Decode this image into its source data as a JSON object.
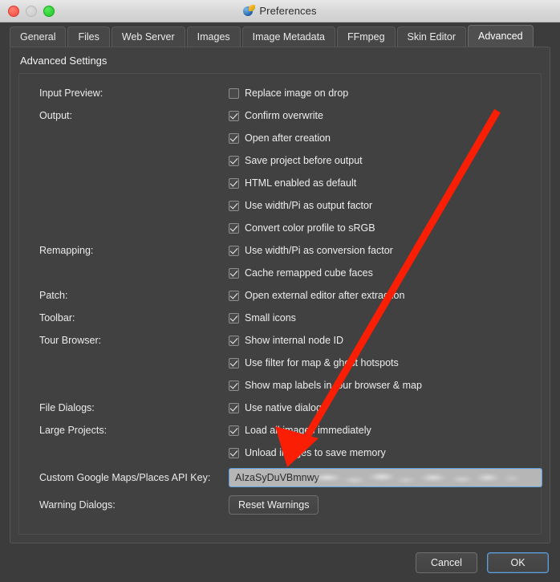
{
  "window": {
    "title": "Preferences",
    "icon": "globe-app-icon",
    "traffic_lights": [
      "close",
      "minimize",
      "maximize"
    ]
  },
  "tabs": [
    {
      "label": "General",
      "active": false
    },
    {
      "label": "Files",
      "active": false
    },
    {
      "label": "Web Server",
      "active": false
    },
    {
      "label": "Images",
      "active": false
    },
    {
      "label": "Image Metadata",
      "active": false
    },
    {
      "label": "FFmpeg",
      "active": false
    },
    {
      "label": "Skin Editor",
      "active": false
    },
    {
      "label": "Advanced",
      "active": true
    }
  ],
  "panel": {
    "title": "Advanced Settings",
    "rows": [
      {
        "label": "Input Preview:",
        "checkbox": {
          "label": "Replace image on drop",
          "checked": false
        }
      },
      {
        "label": "Output:",
        "checkbox": {
          "label": "Confirm overwrite",
          "checked": true
        }
      },
      {
        "label": "",
        "checkbox": {
          "label": "Open after creation",
          "checked": true
        }
      },
      {
        "label": "",
        "checkbox": {
          "label": "Save project before output",
          "checked": true
        }
      },
      {
        "label": "",
        "checkbox": {
          "label": "HTML enabled as default",
          "checked": true
        }
      },
      {
        "label": "",
        "checkbox": {
          "label": "Use width/Pi as output factor",
          "checked": true
        }
      },
      {
        "label": "",
        "checkbox": {
          "label": "Convert color profile to sRGB",
          "checked": true
        }
      },
      {
        "label": "Remapping:",
        "checkbox": {
          "label": "Use width/Pi as conversion factor",
          "checked": true
        }
      },
      {
        "label": "",
        "checkbox": {
          "label": "Cache remapped cube faces",
          "checked": true
        }
      },
      {
        "label": "Patch:",
        "checkbox": {
          "label": "Open external editor after extraction",
          "checked": true
        }
      },
      {
        "label": "Toolbar:",
        "checkbox": {
          "label": "Small icons",
          "checked": true
        }
      },
      {
        "label": "Tour Browser:",
        "checkbox": {
          "label": "Show internal node ID",
          "checked": true
        }
      },
      {
        "label": "",
        "checkbox": {
          "label": "Use filter for map & ghost hotspots",
          "checked": true
        }
      },
      {
        "label": "",
        "checkbox": {
          "label": "Show map labels in tour browser & map",
          "checked": true
        }
      },
      {
        "label": "File Dialogs:",
        "checkbox": {
          "label": "Use native dialogs",
          "checked": true
        }
      },
      {
        "label": "Large Projects:",
        "checkbox": {
          "label": "Load all images immediately",
          "checked": true
        }
      },
      {
        "label": "",
        "checkbox": {
          "label": "Unload images to save memory",
          "checked": true
        }
      }
    ],
    "api_key": {
      "label": "Custom Google Maps/Places API Key:",
      "value": "AIzaSyDuVBmnwy",
      "redacted": true
    },
    "warning_dialogs": {
      "label": "Warning Dialogs:",
      "button": "Reset Warnings"
    }
  },
  "footer": {
    "cancel": "Cancel",
    "ok": "OK"
  },
  "annotation": {
    "type": "arrow",
    "color": "#fa1e05",
    "points_to": "api-key-input"
  },
  "colors": {
    "window_bg": "#3c3c3c",
    "panel_bg": "#414141",
    "tab_active_bg": "#4f4f4f",
    "accent_focus": "#5b9fe0",
    "annotation_red": "#fa1e05"
  }
}
